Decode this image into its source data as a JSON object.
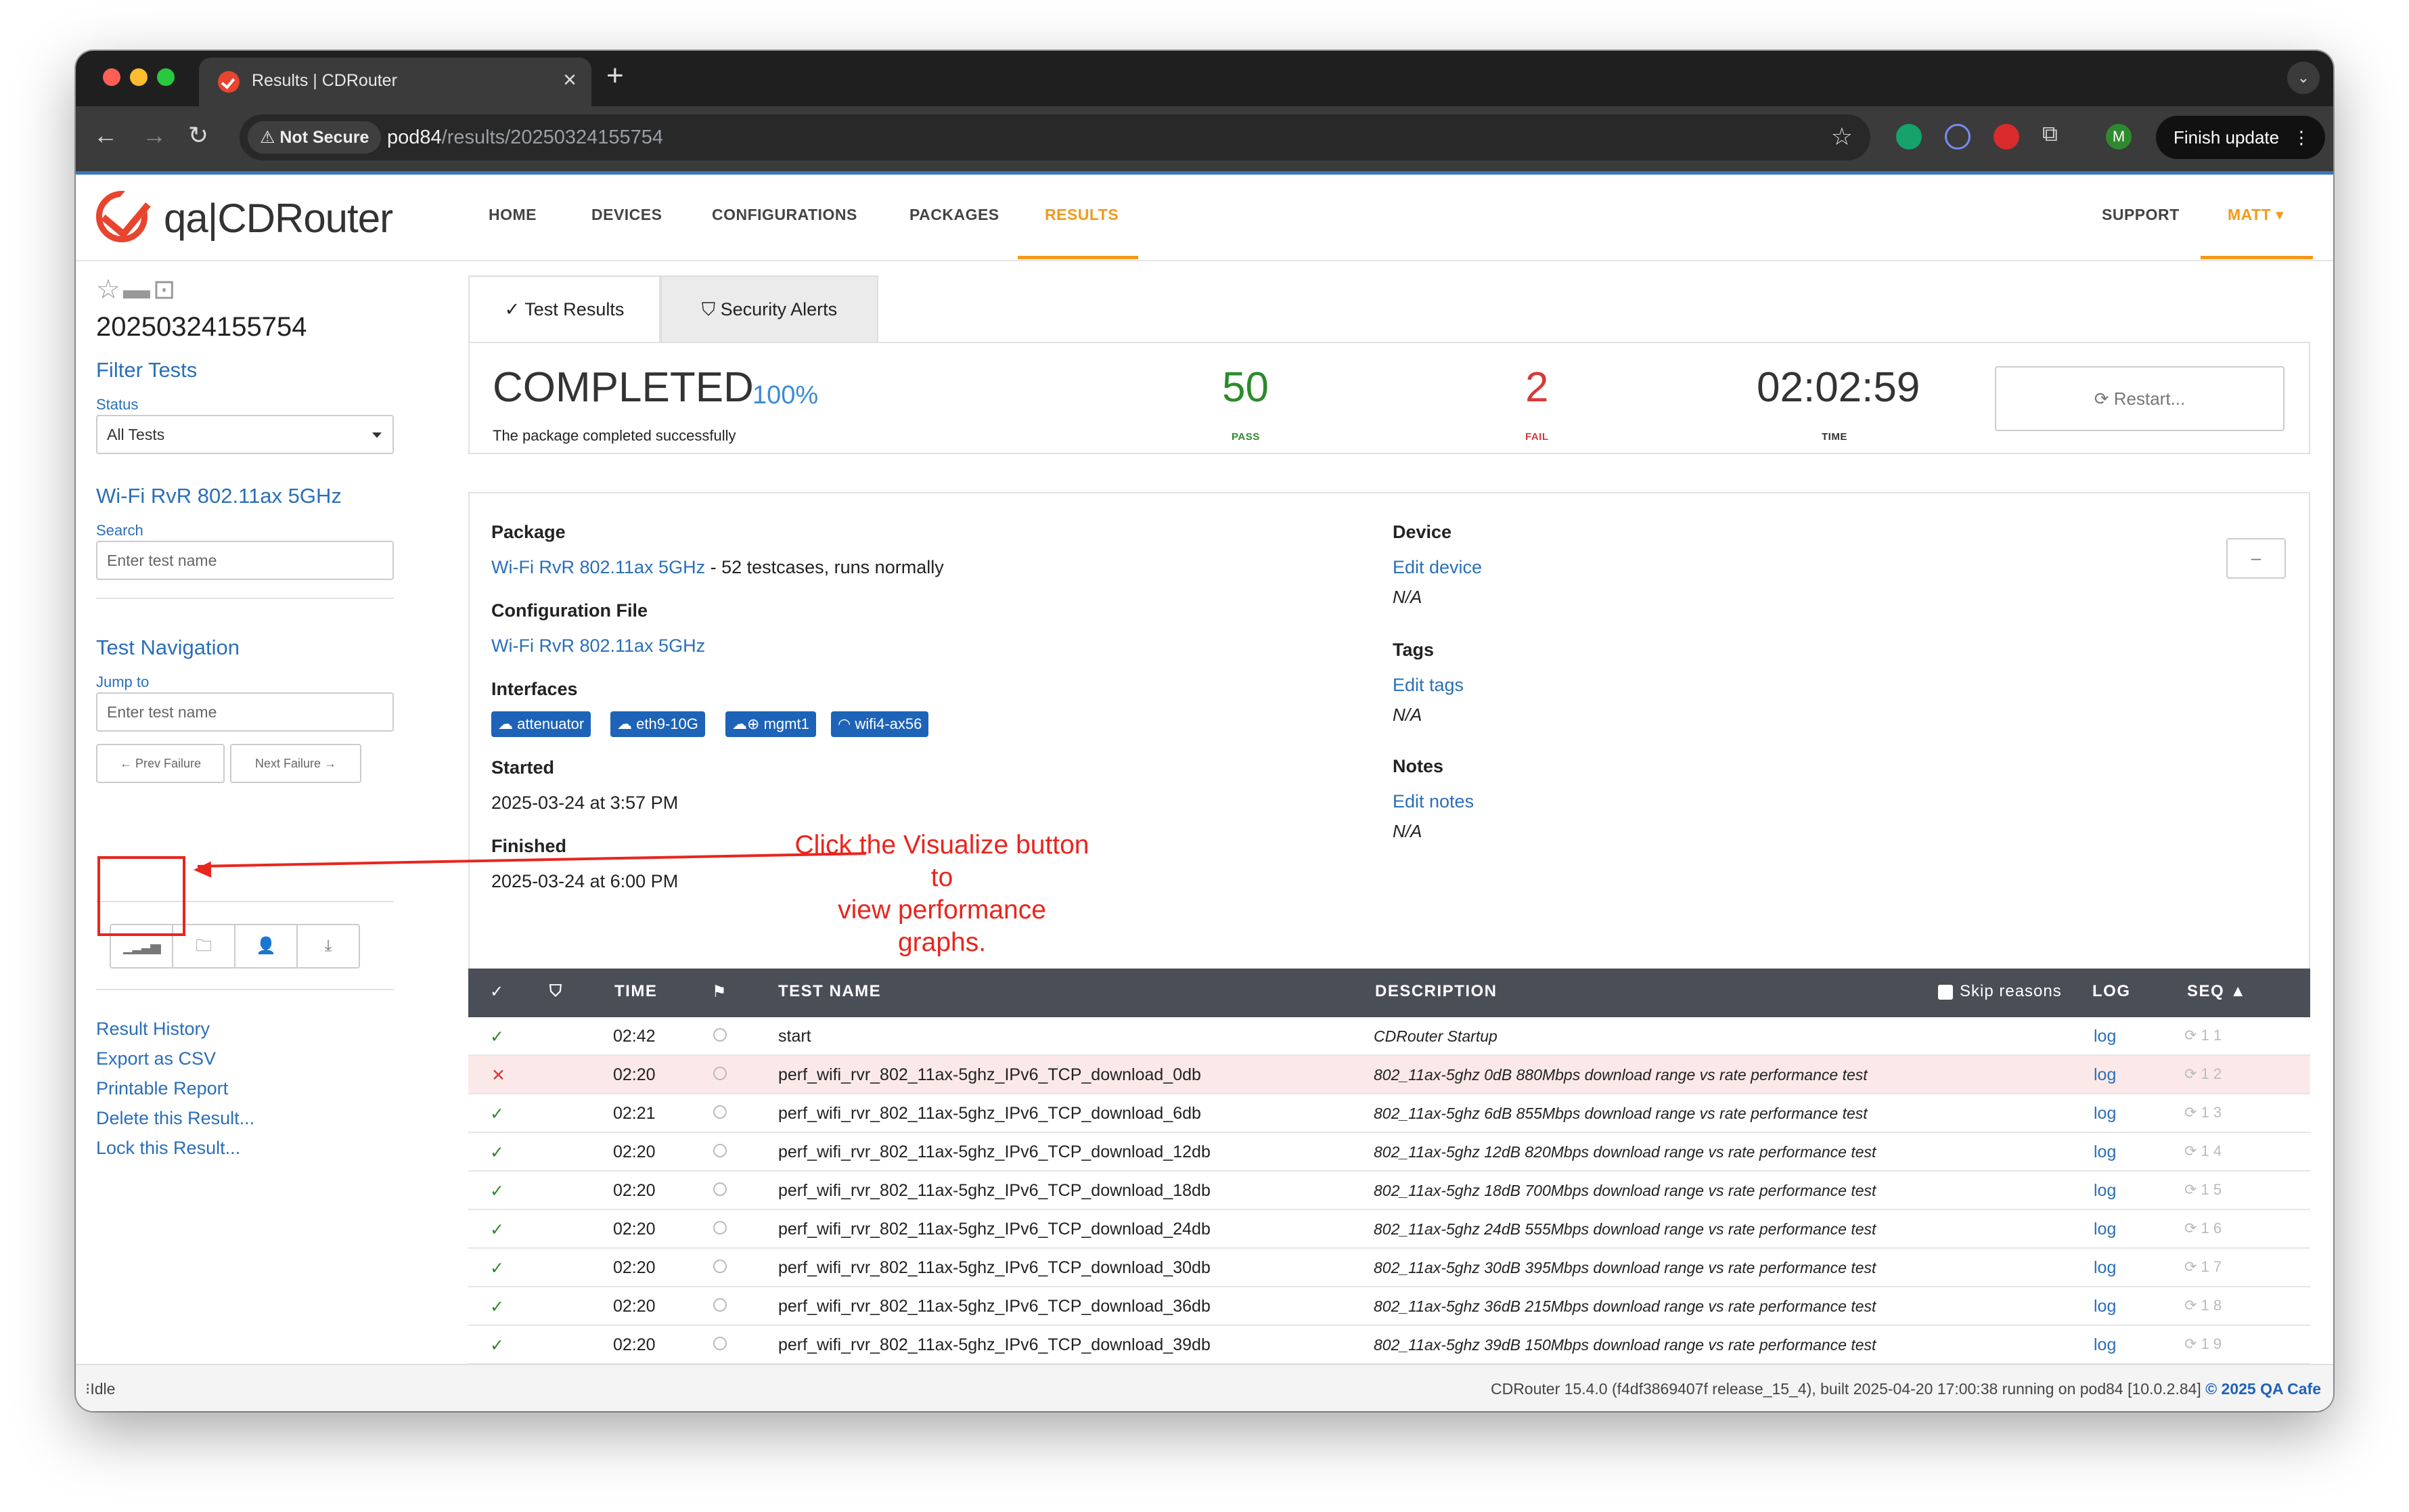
{
  "browser": {
    "tab_title": "Results | CDRouter",
    "not_secure": "Not Secure",
    "url_host": "pod84",
    "url_path": "/results/20250324155754",
    "finish_update": "Finish update",
    "avatar_letter": "M"
  },
  "app": {
    "logo": "qa|CDRouter",
    "nav": [
      "HOME",
      "DEVICES",
      "CONFIGURATIONS",
      "PACKAGES",
      "RESULTS"
    ],
    "active_nav": "RESULTS",
    "support": "SUPPORT",
    "user": "MATT"
  },
  "sidebar": {
    "result_id": "20250324155754",
    "filter_heading": "Filter Tests",
    "status_label": "Status",
    "status_value": "All Tests",
    "package_heading": "Wi-Fi RvR 802.11ax 5GHz",
    "search_label": "Search",
    "search_placeholder": "Enter test name",
    "nav_heading": "Test Navigation",
    "jump_label": "Jump to",
    "jump_placeholder": "Enter test name",
    "prev_failure": "← Prev Failure",
    "next_failure": "Next Failure →",
    "links": [
      "Result History",
      "Export as CSV",
      "Printable Report",
      "Delete this Result...",
      "Lock this Result..."
    ]
  },
  "tabs": {
    "test_results": "Test Results",
    "security_alerts": "Security Alerts"
  },
  "summary": {
    "status": "COMPLETED",
    "percent": "100%",
    "message": "The package completed successfully",
    "pass": "50",
    "pass_label": "PASS",
    "fail": "2",
    "fail_label": "FAIL",
    "time": "02:02:59",
    "time_label": "TIME",
    "restart": "Restart..."
  },
  "details": {
    "package_h": "Package",
    "package_name": "Wi-Fi RvR 802.11ax 5GHz",
    "package_suffix": " - 52 testcases, runs normally",
    "config_h": "Configuration File",
    "config_name": "Wi-Fi RvR 802.11ax 5GHz",
    "interfaces_h": "Interfaces",
    "interfaces": [
      "attenuator",
      "eth9-10G",
      "mgmt1",
      "wifi4-ax56"
    ],
    "started_h": "Started",
    "started": "2025-03-24 at 3:57 PM",
    "finished_h": "Finished",
    "finished": "2025-03-24 at 6:00 PM",
    "device_h": "Device",
    "device_link": "Edit device",
    "device_val": "N/A",
    "tags_h": "Tags",
    "tags_link": "Edit tags",
    "tags_val": "N/A",
    "notes_h": "Notes",
    "notes_link": "Edit notes",
    "notes_val": "N/A",
    "collapse": "–"
  },
  "table": {
    "headers": {
      "time": "TIME",
      "name": "TEST NAME",
      "desc": "DESCRIPTION",
      "skip": "Skip reasons",
      "log": "LOG",
      "seq": "SEQ ▲"
    },
    "rows": [
      {
        "status": "pass",
        "time": "02:42",
        "name": "start",
        "desc": "CDRouter Startup",
        "log": "log",
        "seq": "1  1"
      },
      {
        "status": "fail",
        "time": "02:20",
        "name": "perf_wifi_rvr_802_11ax-5ghz_IPv6_TCP_download_0db",
        "desc": "802_11ax-5ghz 0dB 880Mbps download range vs rate performance test",
        "log": "log",
        "seq": "1  2"
      },
      {
        "status": "pass",
        "time": "02:21",
        "name": "perf_wifi_rvr_802_11ax-5ghz_IPv6_TCP_download_6db",
        "desc": "802_11ax-5ghz 6dB 855Mbps download range vs rate performance test",
        "log": "log",
        "seq": "1  3"
      },
      {
        "status": "pass",
        "time": "02:20",
        "name": "perf_wifi_rvr_802_11ax-5ghz_IPv6_TCP_download_12db",
        "desc": "802_11ax-5ghz 12dB 820Mbps download range vs rate performance test",
        "log": "log",
        "seq": "1  4"
      },
      {
        "status": "pass",
        "time": "02:20",
        "name": "perf_wifi_rvr_802_11ax-5ghz_IPv6_TCP_download_18db",
        "desc": "802_11ax-5ghz 18dB 700Mbps download range vs rate performance test",
        "log": "log",
        "seq": "1  5"
      },
      {
        "status": "pass",
        "time": "02:20",
        "name": "perf_wifi_rvr_802_11ax-5ghz_IPv6_TCP_download_24db",
        "desc": "802_11ax-5ghz 24dB 555Mbps download range vs rate performance test",
        "log": "log",
        "seq": "1  6"
      },
      {
        "status": "pass",
        "time": "02:20",
        "name": "perf_wifi_rvr_802_11ax-5ghz_IPv6_TCP_download_30db",
        "desc": "802_11ax-5ghz 30dB 395Mbps download range vs rate performance test",
        "log": "log",
        "seq": "1  7"
      },
      {
        "status": "pass",
        "time": "02:20",
        "name": "perf_wifi_rvr_802_11ax-5ghz_IPv6_TCP_download_36db",
        "desc": "802_11ax-5ghz 36dB 215Mbps download range vs rate performance test",
        "log": "log",
        "seq": "1  8"
      },
      {
        "status": "pass",
        "time": "02:20",
        "name": "perf_wifi_rvr_802_11ax-5ghz_IPv6_TCP_download_39db",
        "desc": "802_11ax-5ghz 39dB 150Mbps download range vs rate performance test",
        "log": "log",
        "seq": "1  9"
      }
    ]
  },
  "statusbar": {
    "left": "Idle",
    "right": "CDRouter 15.4.0 (f4df3869407f release_15_4), built 2025-04-20 17:00:38 running on pod84 [10.0.2.84]",
    "copyright": "© 2025 QA Cafe"
  },
  "annotation": {
    "line1": "Click the Visualize button to",
    "line2": "view performance graphs."
  },
  "colors": {
    "accent": "#f29a1b",
    "link": "#2a6fb8",
    "pass": "#2c8a2c",
    "fail": "#d63a3a",
    "annotation": "#e8261e"
  },
  "icons": [
    "star-icon",
    "archive-icon",
    "unlock-icon",
    "bar-chart-icon",
    "folder-icon",
    "user-plus-icon",
    "download-icon",
    "shield-icon",
    "flag-icon",
    "check-icon",
    "x-icon",
    "refresh-icon"
  ]
}
